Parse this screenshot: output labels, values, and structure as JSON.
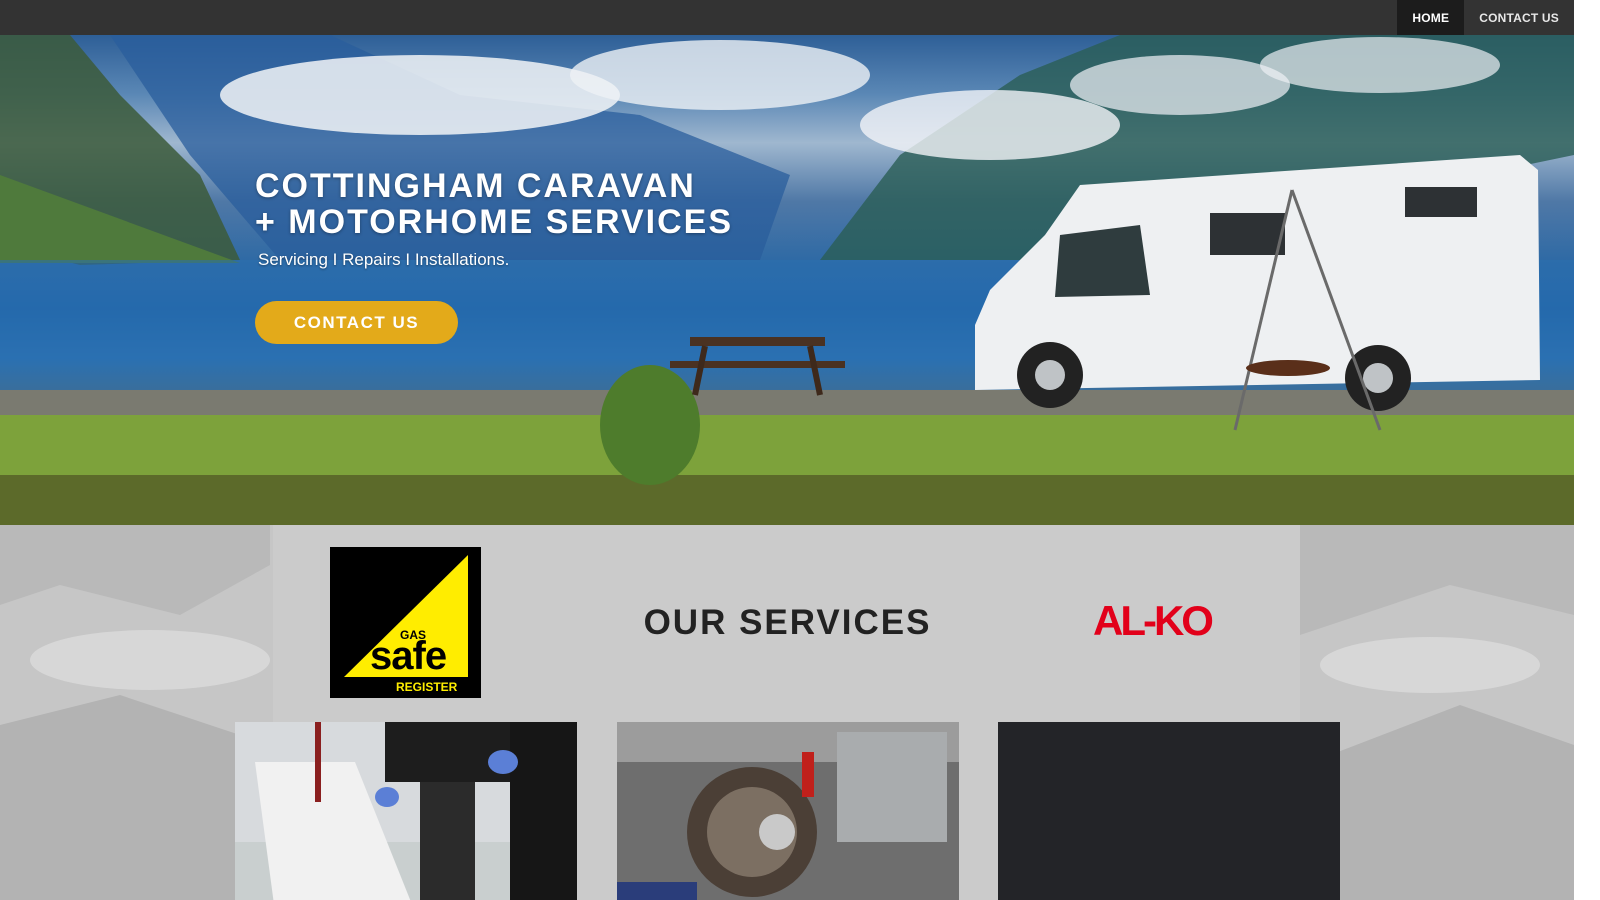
{
  "nav": {
    "items": [
      {
        "label": "HOME",
        "active": true
      },
      {
        "label": "CONTACT US",
        "active": false
      }
    ]
  },
  "hero": {
    "title_line1": "COTTINGHAM CARAVAN",
    "title_line2": "+ MOTORHOME SERVICES",
    "subtitle": "Servicing I Repairs I Installations.",
    "cta_label": "CONTACT US"
  },
  "services": {
    "title": "OUR SERVICES",
    "gas_safe_logo": {
      "line1": "GAS",
      "line2": "safe",
      "line3": "REGISTER"
    },
    "alko_logo": "AL-KO"
  },
  "colors": {
    "nav_bg": "#333333",
    "nav_active_bg": "#1c1c1c",
    "cta_bg": "#e3aa1a",
    "services_bg": "#c4c4c4",
    "alko_red": "#e2001a",
    "gas_safe_yellow": "#ffed00"
  }
}
